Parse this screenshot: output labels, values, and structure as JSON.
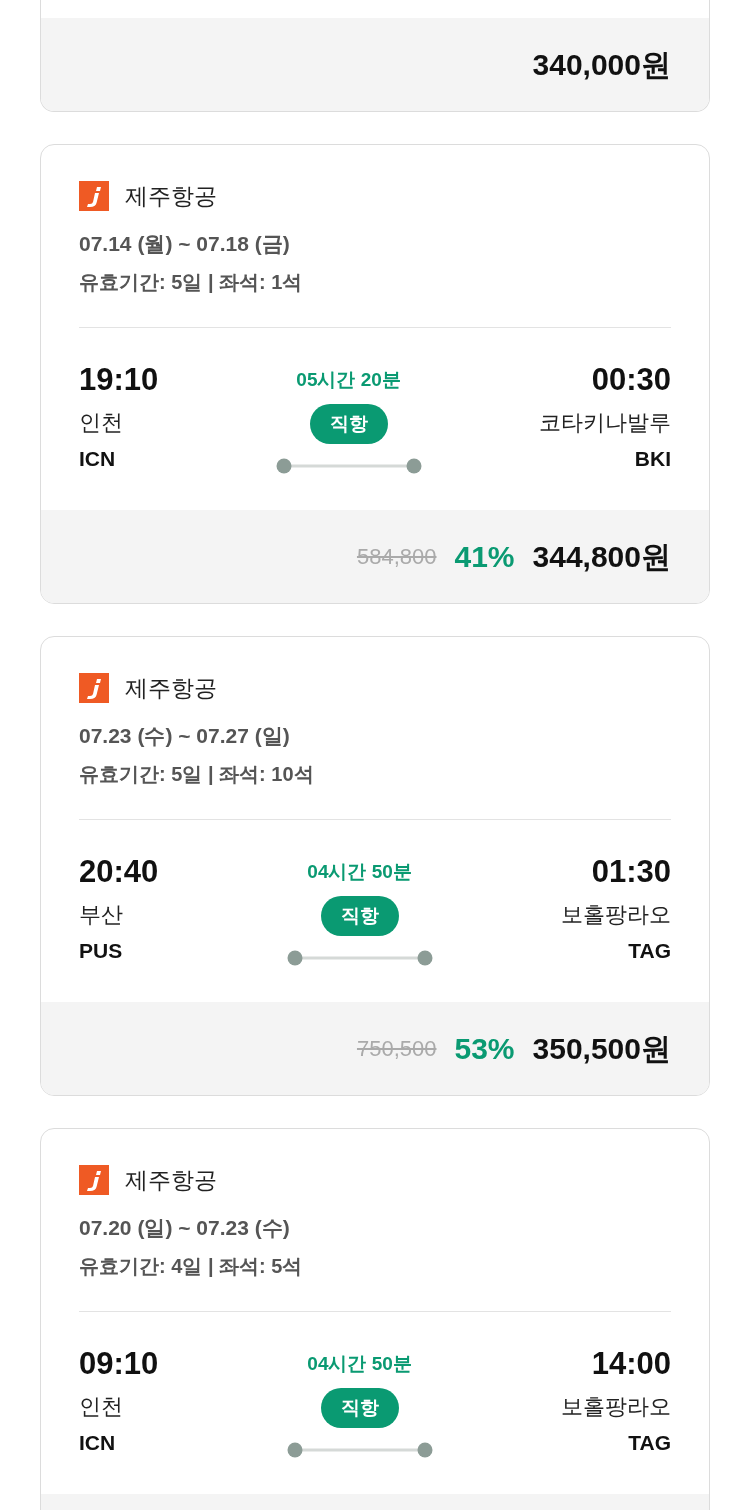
{
  "top_card": {
    "price": "340,000원"
  },
  "flights": [
    {
      "airline": "제주항공",
      "dates": "07.14 (월) ~ 07.18 (금)",
      "validity": "유효기간: 5일 | 좌석: 1석",
      "depart_time": "19:10",
      "depart_city": "인천",
      "depart_code": "ICN",
      "duration": "05시간 20분",
      "flight_type": "직항",
      "arrive_time": "00:30",
      "arrive_city": "코타키나발루",
      "arrive_code": "BKI",
      "original_price": "584,800",
      "discount": "41%",
      "price": "344,800원"
    },
    {
      "airline": "제주항공",
      "dates": "07.23 (수) ~ 07.27 (일)",
      "validity": "유효기간: 5일 | 좌석: 10석",
      "depart_time": "20:40",
      "depart_city": "부산",
      "depart_code": "PUS",
      "duration": "04시간 50분",
      "flight_type": "직항",
      "arrive_time": "01:30",
      "arrive_city": "보홀팡라오",
      "arrive_code": "TAG",
      "original_price": "750,500",
      "discount": "53%",
      "price": "350,500원"
    },
    {
      "airline": "제주항공",
      "dates": "07.20 (일) ~ 07.23 (수)",
      "validity": "유효기간: 4일 | 좌석: 5석",
      "depart_time": "09:10",
      "depart_city": "인천",
      "depart_code": "ICN",
      "duration": "04시간 50분",
      "flight_type": "직항",
      "arrive_time": "14:00",
      "arrive_city": "보홀팡라오",
      "arrive_code": "TAG"
    }
  ]
}
